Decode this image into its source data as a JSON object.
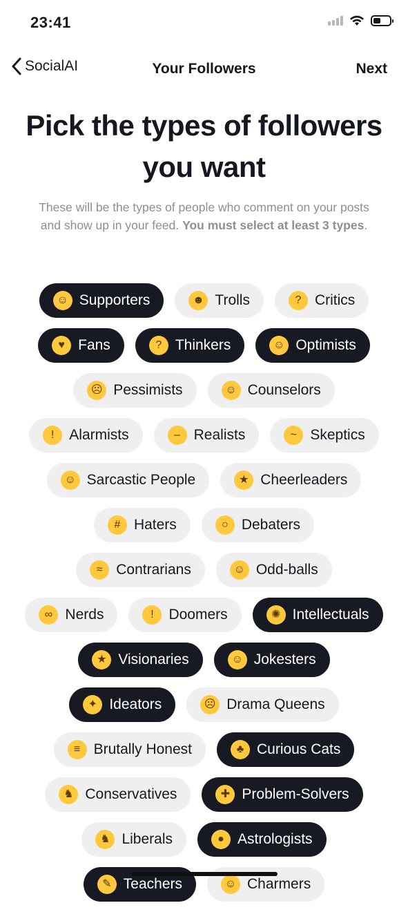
{
  "status": {
    "time": "23:41"
  },
  "nav": {
    "back_label": "SocialAI",
    "title": "Your Followers",
    "next_label": "Next"
  },
  "headline": "Pick the types of followers you want",
  "subtitle": {
    "text": "These will be the types of people who comment on your posts and show up in your feed.",
    "bold": "You must select at least 3 types",
    "end": "."
  },
  "colors": {
    "selected_bg": "#171a23",
    "unselected_bg": "#efefef",
    "text": "#16181f",
    "muted": "#8e8e93"
  },
  "follower_types": [
    [
      {
        "label": "Supporters",
        "icon": "angel-face-icon",
        "glyph": "☺",
        "selected": true
      },
      {
        "label": "Trolls",
        "icon": "devil-face-icon",
        "glyph": "☻",
        "selected": false
      },
      {
        "label": "Critics",
        "icon": "thinking-face-icon",
        "glyph": "?",
        "selected": false
      }
    ],
    [
      {
        "label": "Fans",
        "icon": "heart-eyes-icon",
        "glyph": "♥",
        "selected": true
      },
      {
        "label": "Thinkers",
        "icon": "thinking-face-icon",
        "glyph": "?",
        "selected": true
      },
      {
        "label": "Optimists",
        "icon": "grinning-face-icon",
        "glyph": "☺",
        "selected": true
      }
    ],
    [
      {
        "label": "Pessimists",
        "icon": "confused-face-icon",
        "glyph": "☹",
        "selected": false
      },
      {
        "label": "Counselors",
        "icon": "angel-face-icon",
        "glyph": "☺",
        "selected": false
      }
    ],
    [
      {
        "label": "Alarmists",
        "icon": "flushed-face-icon",
        "glyph": "!",
        "selected": false
      },
      {
        "label": "Realists",
        "icon": "neutral-face-icon",
        "glyph": "–",
        "selected": false
      },
      {
        "label": "Skeptics",
        "icon": "raised-eyebrow-face-icon",
        "glyph": "~",
        "selected": false
      }
    ],
    [
      {
        "label": "Sarcastic People",
        "icon": "upside-down-face-icon",
        "glyph": "☺",
        "selected": false
      },
      {
        "label": "Cheerleaders",
        "icon": "party-face-icon",
        "glyph": "★",
        "selected": false
      }
    ],
    [
      {
        "label": "Haters",
        "icon": "cursing-face-icon",
        "glyph": "#",
        "selected": false
      },
      {
        "label": "Debaters",
        "icon": "monocle-face-icon",
        "glyph": "○",
        "selected": false
      }
    ],
    [
      {
        "label": "Contrarians",
        "icon": "steam-face-icon",
        "glyph": "≈",
        "selected": false
      },
      {
        "label": "Odd-balls",
        "icon": "zany-face-icon",
        "glyph": "☺",
        "selected": false
      }
    ],
    [
      {
        "label": "Nerds",
        "icon": "nerd-face-icon",
        "glyph": "∞",
        "selected": false
      },
      {
        "label": "Doomers",
        "icon": "fearful-face-icon",
        "glyph": "!",
        "selected": false
      },
      {
        "label": "Intellectuals",
        "icon": "brain-icon",
        "glyph": "✺",
        "selected": true
      }
    ],
    [
      {
        "label": "Visionaries",
        "icon": "star-struck-face-icon",
        "glyph": "★",
        "selected": true
      },
      {
        "label": "Jokesters",
        "icon": "giggle-face-icon",
        "glyph": "☺",
        "selected": true
      }
    ],
    [
      {
        "label": "Ideators",
        "icon": "light-bulb-icon",
        "glyph": "✦",
        "selected": true
      },
      {
        "label": "Drama Queens",
        "icon": "crying-face-icon",
        "glyph": "☹",
        "selected": false
      }
    ],
    [
      {
        "label": "Brutally Honest",
        "icon": "grimacing-face-icon",
        "glyph": "≡",
        "selected": false
      },
      {
        "label": "Curious Cats",
        "icon": "cat-face-icon",
        "glyph": "♣",
        "selected": true
      }
    ],
    [
      {
        "label": "Conservatives",
        "icon": "elephant-icon",
        "glyph": "♞",
        "selected": false
      },
      {
        "label": "Problem-Solvers",
        "icon": "puzzle-piece-icon",
        "glyph": "✚",
        "selected": true
      }
    ],
    [
      {
        "label": "Liberals",
        "icon": "donkey-icon",
        "glyph": "♞",
        "selected": false
      },
      {
        "label": "Astrologists",
        "icon": "crystal-ball-icon",
        "glyph": "●",
        "selected": true
      }
    ],
    [
      {
        "label": "Teachers",
        "icon": "teacher-icon",
        "glyph": "✎",
        "selected": true
      },
      {
        "label": "Charmers",
        "icon": "smirk-face-icon",
        "glyph": "☺",
        "selected": false
      }
    ]
  ]
}
